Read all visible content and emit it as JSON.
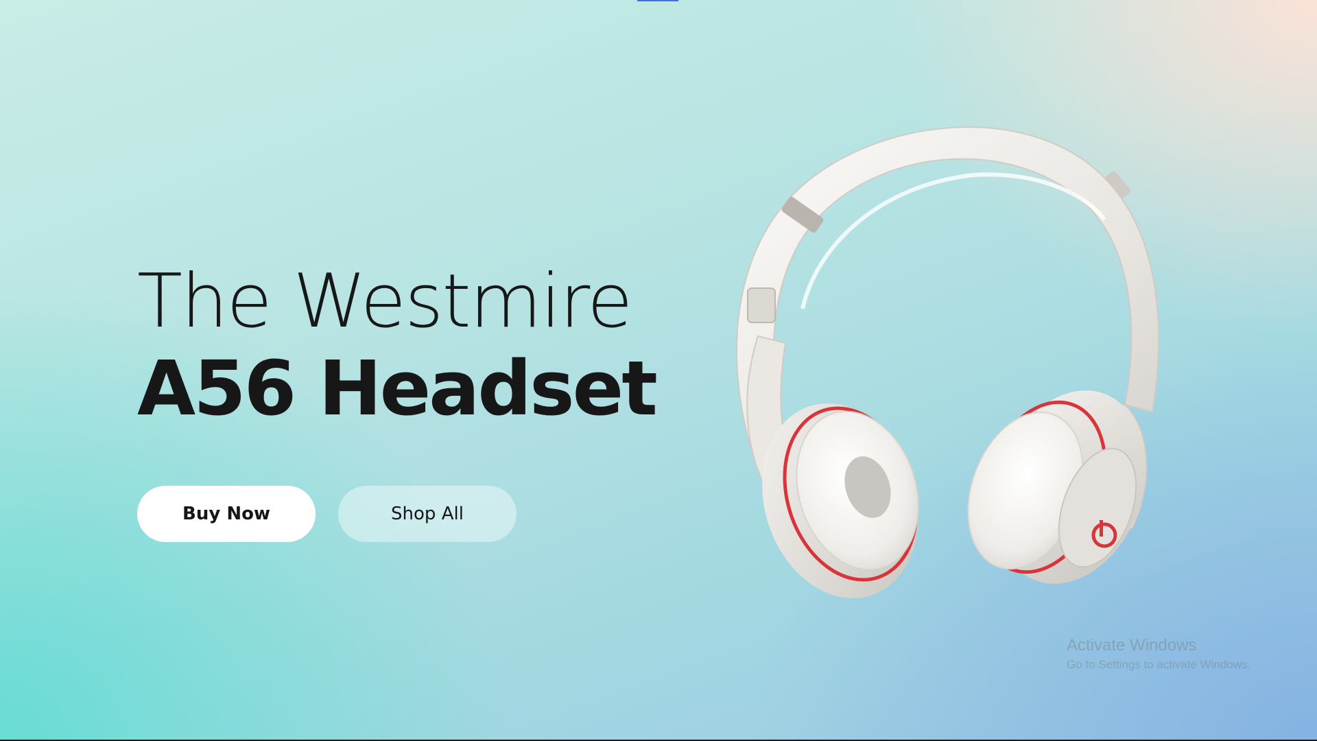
{
  "hero": {
    "title_line1": "The Westmire",
    "title_line2": "A56 Headset"
  },
  "buttons": {
    "buy_now": "Buy Now",
    "shop_all": "Shop All"
  },
  "product": {
    "image_name": "white-headphones-image",
    "brand_accent_color": "#d8343a",
    "body_color": "#f1efec"
  },
  "watermark": {
    "title": "Activate Windows",
    "subtitle": "Go to Settings to activate Windows."
  },
  "colors": {
    "text": "#171717",
    "button_primary_bg": "#ffffff",
    "tab_indicator": "#3f6fd8"
  }
}
